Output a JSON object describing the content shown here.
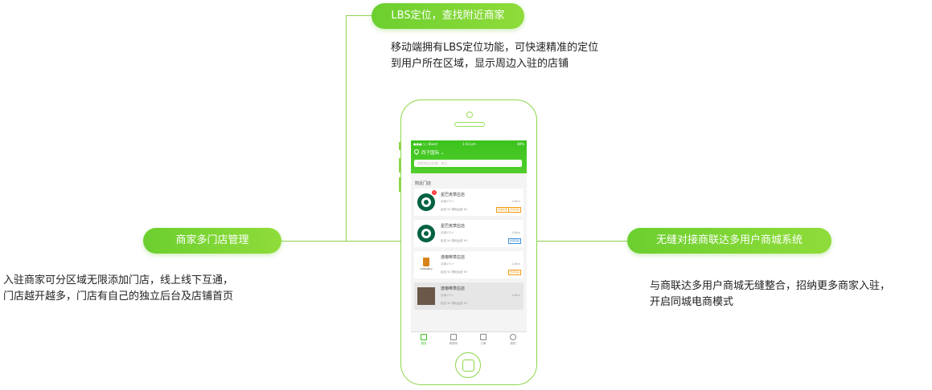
{
  "features": {
    "top": {
      "label": "LBS定位，查找附近商家",
      "desc_line1": "移动端拥有LBS定位功能，可快速精准的定位",
      "desc_line2": "到用户所在区域，显示周边入驻的店铺"
    },
    "left": {
      "label": "商家多门店管理",
      "desc_line1": "入驻商家可分区域无限添加门店，线上线下互通，",
      "desc_line2": "门店越开越多，门店有自己的独立后台及店铺首页"
    },
    "right": {
      "label": "无缝对接商联达多用户商城系统",
      "desc_line1": "与商联达多用户商城无缝整合，招纳更多商家入驻，",
      "desc_line2": "开启同城电商模式"
    }
  },
  "phone": {
    "status": {
      "carrier": "●●●○○ Boost",
      "time": "1:43 pm",
      "battery": "80%"
    },
    "location": "西子国际",
    "search_placeholder": "搜索商品/店铺，商品",
    "section_title": "附近门店",
    "stores": [
      {
        "name": "星巴克草庄店",
        "meta": "月销171+",
        "delivery": "起送 ¥0  基础运费 ¥5",
        "distance": "1.8km",
        "badge": "1",
        "tags": [
          "店铺优惠",
          "支持自提"
        ]
      },
      {
        "name": "星巴克草庄店",
        "meta": "月销171+",
        "delivery": "起送 ¥0  基础运费 ¥5",
        "distance": "1.8km",
        "tags": [
          "支持自提"
        ]
      },
      {
        "name": "逸咖啡草庄店",
        "meta": "月销171+",
        "delivery": "起送 ¥0  基础运费 ¥5",
        "distance": "1.8km",
        "logo_text": "CoffeeBox",
        "tags": [
          "支持自提"
        ]
      },
      {
        "name": "逸咖啡草庄店",
        "meta": "月销171+",
        "delivery": "起送 ¥0  基础运费 ¥5",
        "distance": "1.8km",
        "tags": []
      }
    ],
    "tabs": [
      {
        "label": "首页",
        "icon": "home-icon"
      },
      {
        "label": "购物车",
        "icon": "cart-icon"
      },
      {
        "label": "订单",
        "icon": "order-icon"
      },
      {
        "label": "我的",
        "icon": "user-icon"
      }
    ]
  },
  "colors": {
    "accent": "#5cc92a",
    "line": "#8fd14f"
  }
}
